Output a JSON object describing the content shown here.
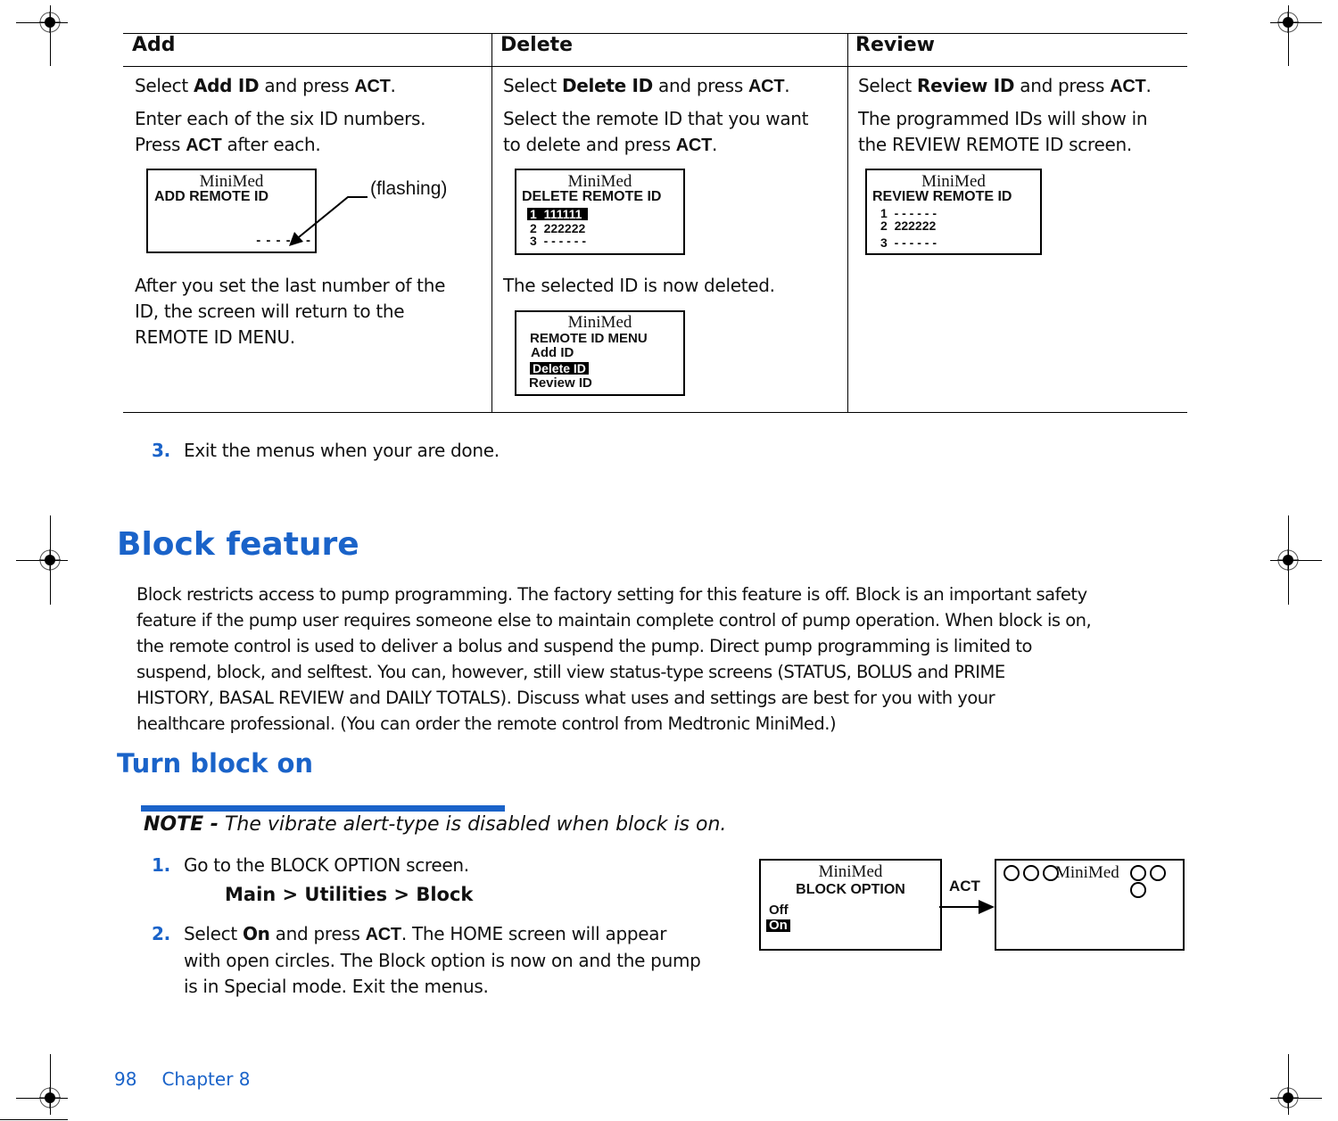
{
  "table": {
    "headers": [
      "Add",
      "Delete",
      "Review"
    ],
    "add": {
      "step1_pre": "Select ",
      "step1_bold": "Add ID",
      "step1_mid": " and press ",
      "step1_act": "ACT",
      "step1_end": ".",
      "step2_line1": "Enter each of the six ID numbers.",
      "step2_pre": "Press ",
      "step2_act": "ACT",
      "step2_end": " after each.",
      "screen": {
        "brand": "MiniMed",
        "title": "ADD REMOTE ID",
        "entry": "- - - - - -"
      },
      "callout": "(flashing)",
      "after_text": [
        "After you set the last number of the",
        "ID, the screen will return to the",
        "REMOTE ID MENU."
      ]
    },
    "delete": {
      "step1_pre": "Select ",
      "step1_bold": "Delete ID",
      "step1_mid": " and press ",
      "step1_act": "ACT",
      "step1_end": ".",
      "step2_line1": "Select the remote ID that you want",
      "step2_pre": "to delete and press ",
      "step2_act": "ACT",
      "step2_end": ".",
      "screen": {
        "brand": "MiniMed",
        "title": "DELETE REMOTE ID",
        "rows": [
          "1  111111 ",
          "2  222222",
          "3  - - - - - -"
        ],
        "selected_index": 0
      },
      "after_text": "The selected ID is now deleted.",
      "menu_screen": {
        "brand": "MiniMed",
        "title": "REMOTE ID MENU",
        "items": [
          "Add ID",
          "Delete ID",
          "Review ID"
        ],
        "selected_index": 1
      }
    },
    "review": {
      "step1_pre": "Select ",
      "step1_bold": "Review ID",
      "step1_mid": " and press ",
      "step1_act": "ACT",
      "step1_end": ".",
      "step2_line1": "The programmed IDs will show in",
      "step2_line2": "the REVIEW REMOTE ID screen.",
      "screen": {
        "brand": "MiniMed",
        "title": "REVIEW REMOTE ID",
        "rows": [
          "1  - - - - - -",
          "2  222222",
          "3  - - - - - -"
        ]
      }
    }
  },
  "step3": {
    "num": "3.",
    "text": "Exit the menus when your are done."
  },
  "block_feature": {
    "heading": "Block feature",
    "paragraph": [
      "Block restricts access to pump programming. The factory setting for this feature is off. Block is an important safety",
      "feature if the pump user requires someone else to maintain complete control of pump operation. When block is on,",
      "the remote control is used to deliver a bolus and suspend the pump. Direct pump programming is limited to",
      "suspend, block, and selftest. You can, however, still view status-type screens (STATUS, BOLUS and PRIME",
      "HISTORY, BASAL REVIEW and DAILY TOTALS). Discuss what uses and settings are best for you with your",
      "healthcare professional. (You can order the remote control from Medtronic MiniMed.)"
    ]
  },
  "turn_block_on": {
    "heading": "Turn block on",
    "note_label": "NOTE -",
    "note_text": " The vibrate alert-type is disabled when block is on.",
    "steps": [
      {
        "num": "1.",
        "text": "Go to the BLOCK OPTION screen.",
        "path": "Main > Utilities > Block"
      },
      {
        "num": "2.",
        "pre": "Select ",
        "bold": "On",
        "mid": " and press ",
        "act": "ACT",
        "post": ". The HOME screen will appear",
        "line2": "with open circles. The Block option is now on and the pump",
        "line3": "is in Special mode. Exit the menus."
      }
    ],
    "block_screen": {
      "brand": "MiniMed",
      "title": "BLOCK OPTION",
      "options": [
        "Off",
        "On"
      ],
      "selected_index": 1
    },
    "arrow_label": "ACT",
    "home_screen": {
      "brand": "MiniMed",
      "left_circles": 3,
      "right_circles": 3
    }
  },
  "footer": {
    "page_number": "98",
    "chapter": "Chapter 8"
  },
  "colors": {
    "accent_blue": "#1a63c9",
    "text": "#111111"
  }
}
